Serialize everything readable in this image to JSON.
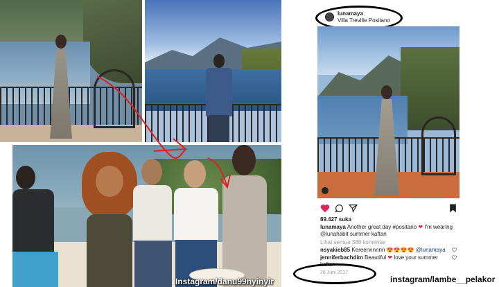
{
  "watermarks": {
    "left": "Instagram/danu99nyinyir",
    "right": "instagram/lambe__pelakor"
  },
  "post": {
    "username": "lunamaya",
    "location": "Villa Treville Positano",
    "likes": "89.427 suka",
    "caption_user": "lunamaya",
    "caption_text": "Another great day #positano",
    "caption_text2": "I'm wearing",
    "caption_line2": "@lunahabit summer kaftan",
    "view_comments": "Lihat semua 388 komentar",
    "comments": [
      {
        "user": "nsyakieb85",
        "text": "Kereennnnnn",
        "tail": "@lunamaya"
      },
      {
        "user": "jenniferbachdim",
        "text": "Beautiful",
        "tail": "love your summer",
        "line2": "kaftan"
      }
    ],
    "date": "26 Juni 2017"
  },
  "colors": {
    "heart": "#e0245e",
    "annotation_red": "#e02020"
  },
  "icons": [
    "heart-icon",
    "comment-icon",
    "share-icon",
    "bookmark-icon"
  ]
}
